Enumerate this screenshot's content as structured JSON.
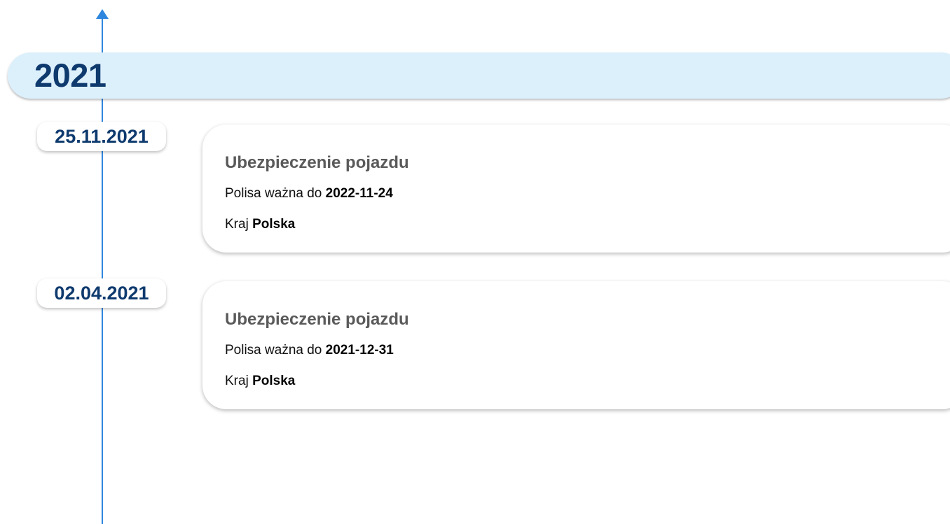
{
  "year": "2021",
  "entries": [
    {
      "date": "25.11.2021",
      "title": "Ubezpieczenie pojazdu",
      "valid_label": "Polisa ważna do",
      "valid_value": "2022-11-24",
      "country_label": "Kraj",
      "country_value": "Polska"
    },
    {
      "date": "02.04.2021",
      "title": "Ubezpieczenie pojazdu",
      "valid_label": "Polisa ważna do",
      "valid_value": "2021-12-31",
      "country_label": "Kraj",
      "country_value": "Polska"
    }
  ],
  "colors": {
    "timeline": "#2f86de",
    "year_band": "#dcf0fc",
    "year_text": "#0e3a6e",
    "date_text": "#0e3a6e",
    "title_text": "#5a5a5a"
  }
}
